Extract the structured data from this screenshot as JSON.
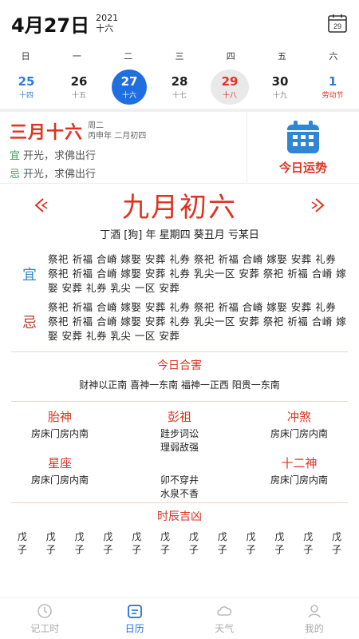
{
  "header": {
    "date": "4月27日",
    "year": "2021",
    "lunar_day": "十六",
    "calendar_badge": "29"
  },
  "weekdays": [
    "日",
    "一",
    "二",
    "三",
    "四",
    "五",
    "六"
  ],
  "days": [
    {
      "num": "25",
      "sub": "十四"
    },
    {
      "num": "26",
      "sub": "十五"
    },
    {
      "num": "27",
      "sub": "十六"
    },
    {
      "num": "28",
      "sub": "十七"
    },
    {
      "num": "29",
      "sub": "十八"
    },
    {
      "num": "30",
      "sub": "十九"
    },
    {
      "num": "1",
      "sub": "劳动节"
    }
  ],
  "topcard": {
    "lunar": "三月十六",
    "weekday": "周二",
    "ganzhi_line": "丙申年 二月初四",
    "yi_tag": "宜",
    "yi_text": "开光，求佛出行",
    "ji_tag": "忌",
    "ji_text": "开光，求佛出行",
    "fortune_label": "今日运势"
  },
  "main": {
    "lunar_title": "九月初六",
    "ganzhi": "丁酒 [狗] 年  星期四  葵丑月  亏某日",
    "yi_mark": "宜",
    "yi_items": "祭祀 祈福 合嵴 嫁娶 安葬 礼券 祭祀 祈福 合嵴 嫁娶 安葬 礼券 祭祀 祈福 合嵴 嫁娶 安葬 礼券 乳尖一区 安葬 祭祀 祈福 合嵴 嫁娶 安葬 礼券 乳尖 一区 安葬",
    "ji_mark": "忌",
    "ji_items": "祭祀 祈福 合嵴 嫁娶 安葬 礼券 祭祀 祈福 合嵴 嫁娶 安葬 礼券 祭祀 祈福 合嵴 嫁娶 安葬 礼券 乳尖一区 安葬 祭祀 祈福 合嵴 嫁娶 安葬 礼券 乳尖 一区 安葬"
  },
  "hehai": {
    "title": "今日合害",
    "body": "财神以正南 喜神一东南 福神一正西 阳贵一东南"
  },
  "grid": [
    {
      "title": "胎神",
      "body1": "房床门房内南",
      "body2": ""
    },
    {
      "title": "彭祖",
      "body1": "跬步词讼",
      "body2": "理弱敌强"
    },
    {
      "title": "冲煞",
      "body1": "房床门房内南",
      "body2": ""
    },
    {
      "title": "星座",
      "body1": "房床门房内南",
      "body2": ""
    },
    {
      "title": "",
      "body1": "卯不穿井",
      "body2": "水泉不香"
    },
    {
      "title": "十二神",
      "body1": "房床门房内南",
      "body2": ""
    }
  ],
  "hours": {
    "title": "时辰吉凶",
    "items": [
      {
        "a": "戊",
        "b": "子"
      },
      {
        "a": "戊",
        "b": "子"
      },
      {
        "a": "戊",
        "b": "子"
      },
      {
        "a": "戊",
        "b": "子"
      },
      {
        "a": "戊",
        "b": "子"
      },
      {
        "a": "戊",
        "b": "子"
      },
      {
        "a": "戊",
        "b": "子"
      },
      {
        "a": "戊",
        "b": "子"
      },
      {
        "a": "戊",
        "b": "子"
      },
      {
        "a": "戊",
        "b": "子"
      },
      {
        "a": "戊",
        "b": "子"
      },
      {
        "a": "戊",
        "b": "子"
      }
    ]
  },
  "tabs": [
    {
      "label": "记工时",
      "icon": "clock-icon"
    },
    {
      "label": "日历",
      "icon": "calendar-icon"
    },
    {
      "label": "天气",
      "icon": "weather-icon"
    },
    {
      "label": "我的",
      "icon": "user-icon"
    }
  ],
  "colors": {
    "accent": "#1f6fe0",
    "red": "#d32f2f",
    "green": "#2e9d5a"
  }
}
